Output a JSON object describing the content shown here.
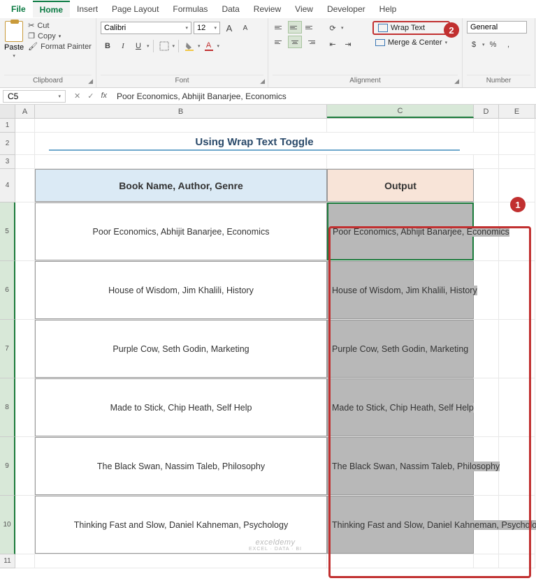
{
  "tabs": {
    "file": "File",
    "home": "Home",
    "insert": "Insert",
    "pagelayout": "Page Layout",
    "formulas": "Formulas",
    "data": "Data",
    "review": "Review",
    "view": "View",
    "developer": "Developer",
    "help": "Help"
  },
  "clipboard": {
    "cut": "Cut",
    "copy": "Copy",
    "format": "Format Painter",
    "paste": "Paste",
    "label": "Clipboard"
  },
  "font": {
    "name": "Calibri",
    "size": "12",
    "increase": "A",
    "decrease": "A",
    "bold": "B",
    "italic": "I",
    "underline": "U",
    "label": "Font"
  },
  "alignment": {
    "wrap": "Wrap Text",
    "merge": "Merge & Center",
    "label": "Alignment"
  },
  "number": {
    "format": "General",
    "label": "Number"
  },
  "namebox": "C5",
  "fx": "fx",
  "formula": "Poor Economics, Abhijit Banarjee, Economics",
  "cols": {
    "A": "A",
    "B": "B",
    "C": "C",
    "D": "D",
    "E": "E"
  },
  "rows": [
    "1",
    "2",
    "3",
    "4",
    "5",
    "6",
    "7",
    "8",
    "9",
    "10",
    "11"
  ],
  "title": "Using Wrap Text Toggle",
  "headers": {
    "b": "Book Name, Author, Genre",
    "c": "Output"
  },
  "dataRows": [
    {
      "b": "Poor Economics, Abhijit Banarjee, Economics",
      "c": "Poor Economics, Abhijit Banarjee, Economics"
    },
    {
      "b": "House of Wisdom, Jim Khalili, History",
      "c": "House of Wisdom, Jim Khalili, History"
    },
    {
      "b": "Purple Cow, Seth Godin, Marketing",
      "c": "Purple Cow, Seth Godin, Marketing"
    },
    {
      "b": "Made to Stick, Chip Heath, Self Help",
      "c": "Made to Stick, Chip Heath, Self Help"
    },
    {
      "b": "The Black Swan, Nassim Taleb, Philosophy",
      "c": "The Black Swan, Nassim Taleb, Philosophy"
    },
    {
      "b": "Thinking Fast and Slow, Daniel Kahneman, Psychology",
      "c": "Thinking Fast and Slow, Daniel Kahneman, Psychology"
    }
  ],
  "badges": {
    "one": "1",
    "two": "2"
  },
  "watermark": {
    "main": "exceldemy",
    "sub": "EXCEL · DATA · BI"
  }
}
